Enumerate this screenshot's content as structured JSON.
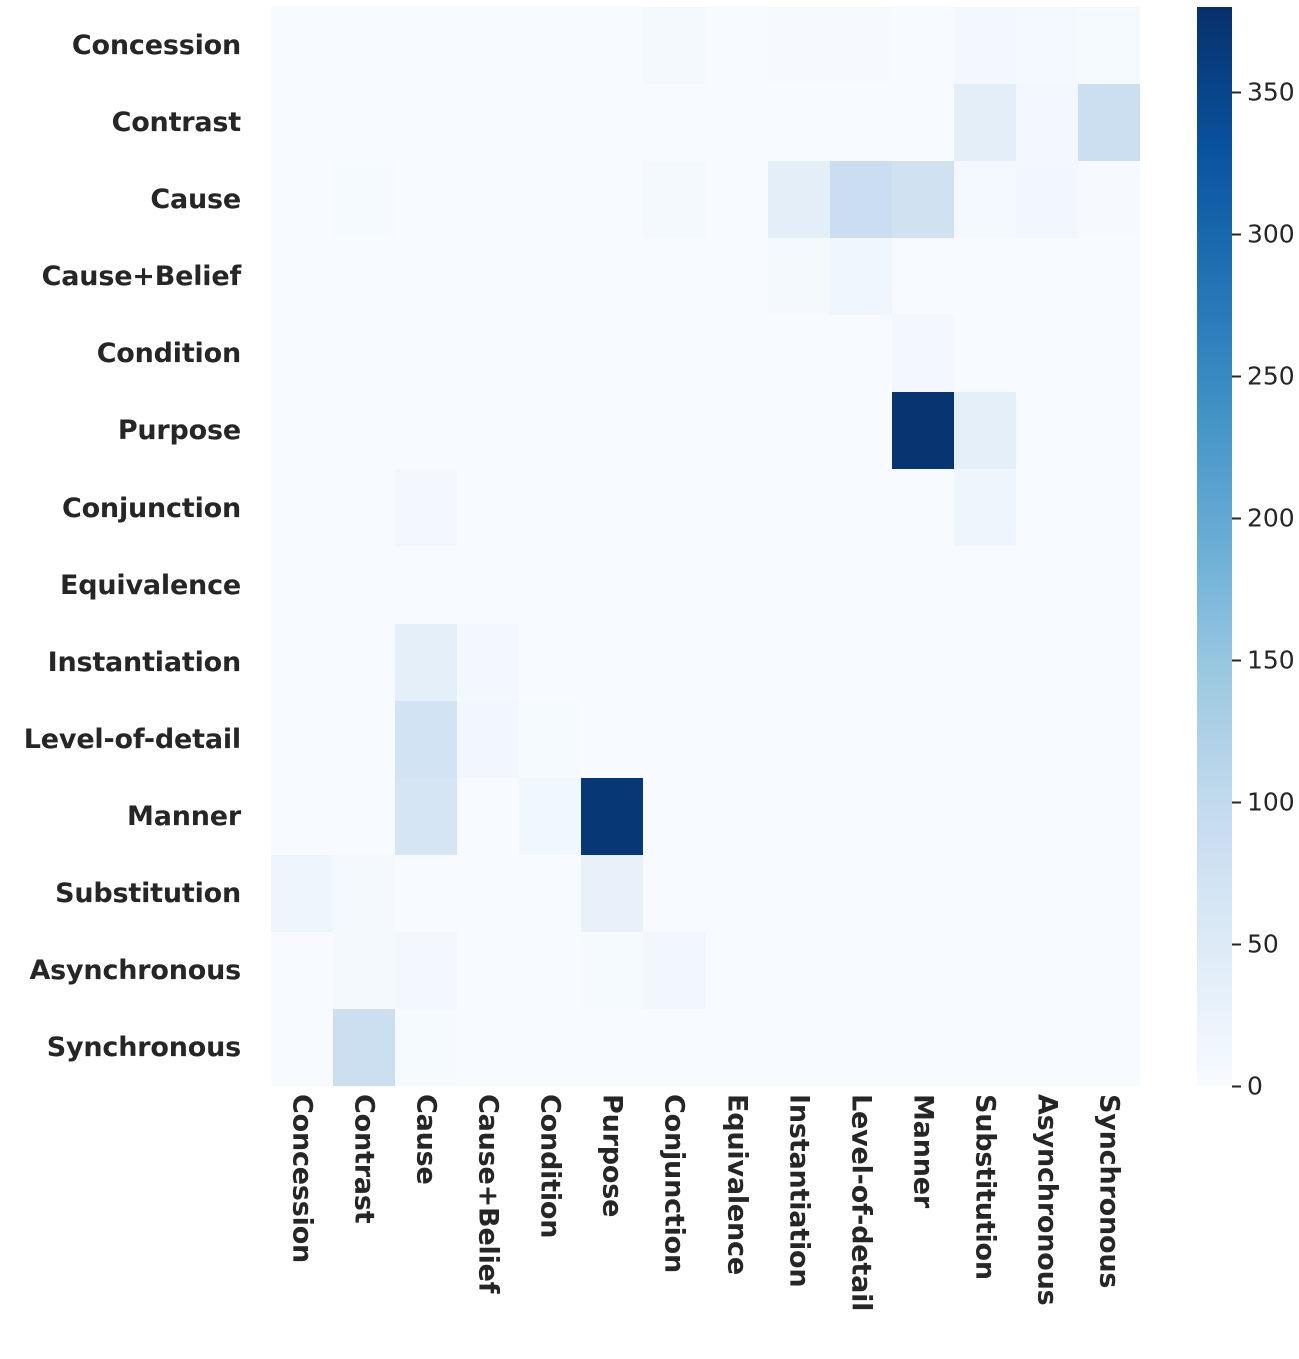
{
  "chart_data": {
    "type": "heatmap",
    "title": "",
    "xlabel": "",
    "ylabel": "",
    "grid": false,
    "legend_position": "right",
    "colormap": "Blues",
    "colorbar": {
      "min": 0,
      "max": 380,
      "ticks": [
        0,
        50,
        100,
        150,
        200,
        250,
        300,
        350
      ],
      "tick_labels": [
        "0",
        "50",
        "100",
        "150",
        "200",
        "250",
        "300",
        "350"
      ],
      "orientation": "vertical"
    },
    "x_categories": [
      "Concession",
      "Contrast",
      "Cause",
      "Cause+Belief",
      "Condition",
      "Purpose",
      "Conjunction",
      "Equivalence",
      "Instantiation",
      "Level-of-detail",
      "Manner",
      "Substitution",
      "Asynchronous",
      "Synchronous"
    ],
    "y_categories": [
      "Concession",
      "Contrast",
      "Cause",
      "Cause+Belief",
      "Condition",
      "Purpose",
      "Conjunction",
      "Equivalence",
      "Instantiation",
      "Level-of-detail",
      "Manner",
      "Substitution",
      "Asynchronous",
      "Synchronous"
    ],
    "rows": [
      {
        "label": "Concession",
        "values": [
          0,
          0,
          0,
          0,
          0,
          0,
          6,
          0,
          2,
          2,
          0,
          8,
          7,
          3
        ]
      },
      {
        "label": "Contrast",
        "values": [
          0,
          0,
          0,
          0,
          0,
          0,
          0,
          0,
          0,
          0,
          0,
          38,
          9,
          83
        ]
      },
      {
        "label": "Cause",
        "values": [
          0,
          3,
          0,
          0,
          0,
          0,
          6,
          0,
          38,
          86,
          76,
          7,
          11,
          2
        ]
      },
      {
        "label": "Cause+Belief",
        "values": [
          0,
          0,
          0,
          0,
          0,
          0,
          0,
          0,
          5,
          14,
          0,
          0,
          0,
          0
        ]
      },
      {
        "label": "Condition",
        "values": [
          0,
          0,
          0,
          0,
          0,
          0,
          0,
          0,
          0,
          0,
          9,
          0,
          0,
          0
        ]
      },
      {
        "label": "Purpose",
        "values": [
          0,
          0,
          0,
          0,
          0,
          0,
          0,
          0,
          0,
          0,
          373,
          35,
          0,
          0
        ]
      },
      {
        "label": "Conjunction",
        "values": [
          0,
          0,
          8,
          0,
          0,
          0,
          0,
          0,
          0,
          0,
          0,
          18,
          0,
          0
        ]
      },
      {
        "label": "Equivalence",
        "values": [
          0,
          0,
          0,
          0,
          0,
          0,
          0,
          0,
          0,
          0,
          0,
          0,
          0,
          0
        ]
      },
      {
        "label": "Instantiation",
        "values": [
          0,
          0,
          37,
          8,
          0,
          0,
          0,
          0,
          0,
          0,
          0,
          0,
          0,
          0
        ]
      },
      {
        "label": "Level-of-detail",
        "values": [
          0,
          0,
          71,
          12,
          3,
          0,
          0,
          0,
          0,
          0,
          0,
          0,
          0,
          0
        ]
      },
      {
        "label": "Manner",
        "values": [
          0,
          0,
          65,
          0,
          13,
          370,
          0,
          0,
          0,
          0,
          0,
          0,
          0,
          0
        ]
      },
      {
        "label": "Substitution",
        "values": [
          17,
          5,
          0,
          0,
          0,
          29,
          0,
          0,
          0,
          0,
          0,
          0,
          0,
          0
        ]
      },
      {
        "label": "Asynchronous",
        "values": [
          0,
          5,
          10,
          0,
          0,
          4,
          12,
          0,
          0,
          0,
          0,
          0,
          0,
          0
        ]
      },
      {
        "label": "Synchronous",
        "values": [
          0,
          84,
          4,
          0,
          0,
          0,
          0,
          0,
          0,
          0,
          0,
          0,
          0,
          0
        ]
      }
    ]
  }
}
